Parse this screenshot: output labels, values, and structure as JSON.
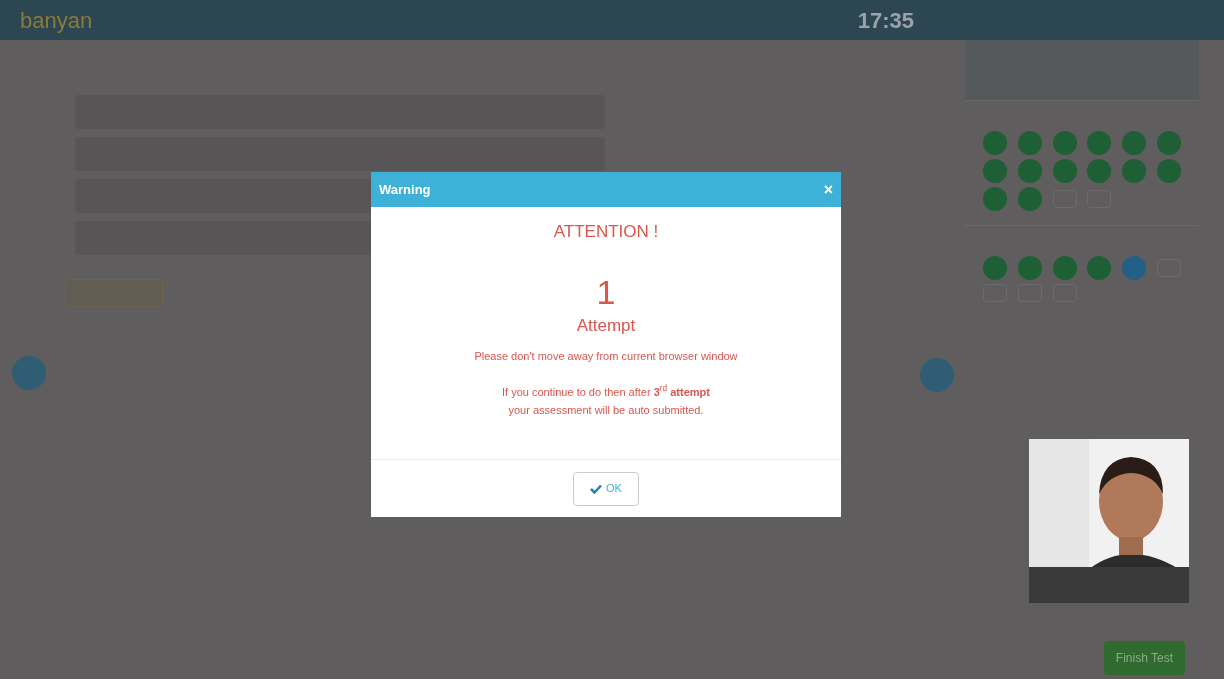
{
  "header": {
    "logo": "banyan",
    "timer": "17:35"
  },
  "palette": [
    {
      "questions": [
        {
          "kind": "answered"
        },
        {
          "kind": "answered"
        },
        {
          "kind": "answered"
        },
        {
          "kind": "answered"
        },
        {
          "kind": "answered"
        },
        {
          "kind": "answered"
        },
        {
          "kind": "answered"
        },
        {
          "kind": "answered"
        },
        {
          "kind": "answered"
        },
        {
          "kind": "answered"
        },
        {
          "kind": "answered"
        },
        {
          "kind": "answered"
        },
        {
          "kind": "answered"
        },
        {
          "kind": "answered"
        },
        {
          "kind": "unvisited"
        },
        {
          "kind": "unvisited"
        }
      ]
    },
    {
      "questions": [
        {
          "kind": "answered"
        },
        {
          "kind": "answered"
        },
        {
          "kind": "answered"
        },
        {
          "kind": "answered"
        },
        {
          "kind": "current"
        },
        {
          "kind": "unvisited"
        },
        {
          "kind": "unvisited"
        },
        {
          "kind": "unvisited"
        },
        {
          "kind": "unvisited"
        }
      ]
    }
  ],
  "modal": {
    "title": "Warning",
    "close": "×",
    "heading": "ATTENTION !",
    "count": "1",
    "count_label": "Attempt",
    "message": "Please don't move away from current browser window",
    "note_lines": [
      "If you continue to do then after **3**$^{rd}$ **attempt**",
      "your assessment will be auto submitted."
    ],
    "ok_button": "OK"
  },
  "finish_button": "Finish Test"
}
